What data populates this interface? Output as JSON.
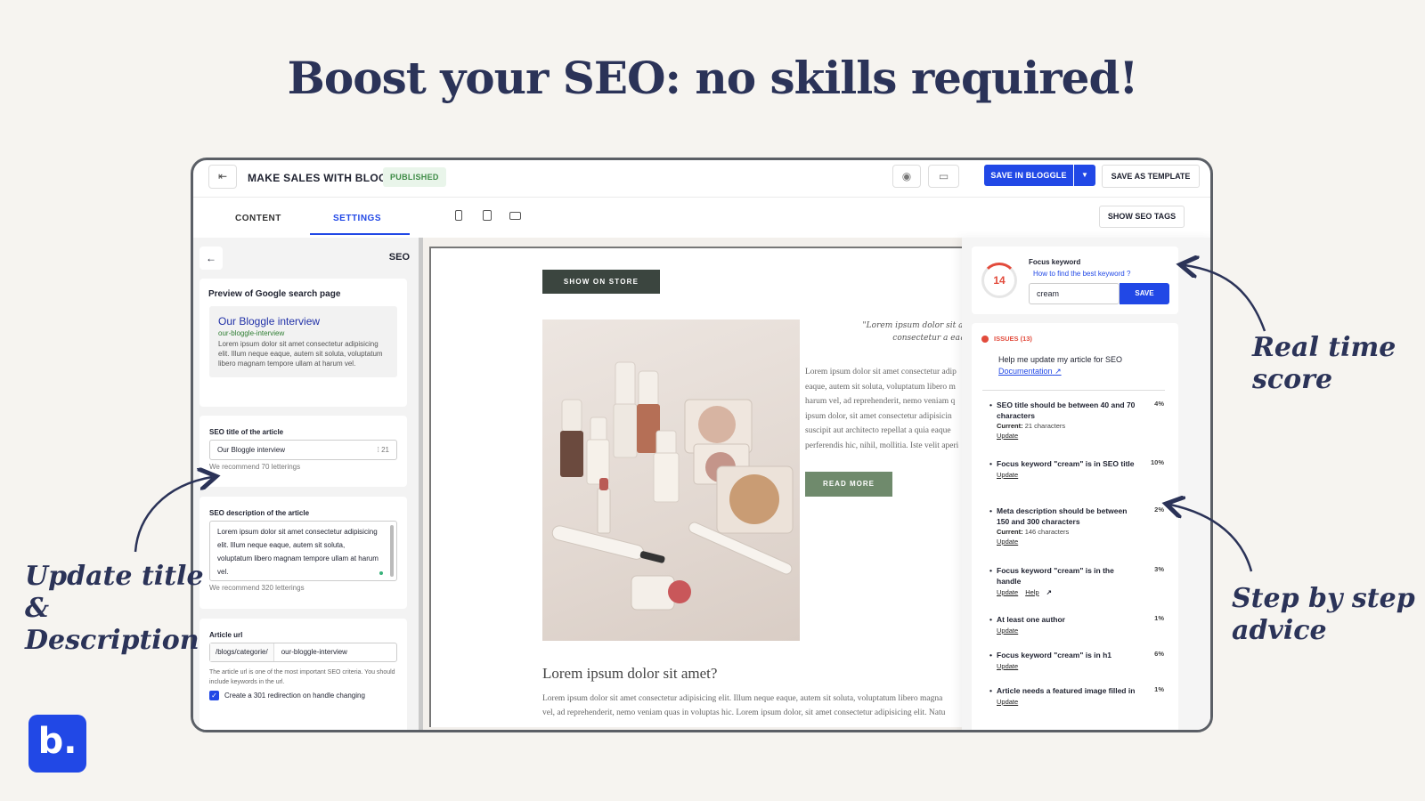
{
  "headline": "Boost your SEO: no skills required!",
  "topbar": {
    "back_icon": "exit-icon",
    "title": "MAKE SALES WITH BLOG",
    "status": "PUBLISHED",
    "save_label": "SAVE IN BLOGGLE",
    "save_template_label": "SAVE AS TEMPLATE",
    "accent": "#2148e6"
  },
  "tabs": [
    {
      "label": "CONTENT"
    },
    {
      "label": "SETTINGS"
    }
  ],
  "show_seo_tags": "SHOW SEO TAGS",
  "left": {
    "section": "SEO",
    "preview_heading": "Preview of Google search page",
    "google": {
      "title": "Our Bloggle interview",
      "url": "our-bloggle-interview",
      "desc": "Lorem ipsum dolor sit amet consectetur adipisicing elit. Illum neque eaque, autem sit soluta, voluptatum libero magnam tempore ullam at harum vel."
    },
    "seo_title_label": "SEO title of the article",
    "seo_title_value": "Our Bloggle interview",
    "seo_title_count": "21",
    "seo_title_hint": "We recommend 70 letterings",
    "seo_desc_label": "SEO description of the article",
    "seo_desc_value": "Lorem ipsum dolor sit amet consectetur adipisicing elit. Illum neque eaque, autem sit soluta, voluptatum libero magnam tempore ullam at harum vel.",
    "seo_desc_hint": "We recommend 320 letterings",
    "url_label": "Article url",
    "url_prefix": "/blogs/categorie/",
    "url_value": "our-bloggle-interview",
    "url_note": "The article url is one of the most important SEO criteria. You should include keywords in the url.",
    "redirect_label": "Create a 301 redirection on handle changing"
  },
  "preview": {
    "show_store": "SHOW ON STORE",
    "quote": "\"Lorem ipsum dolor sit amet consectetur a eaque\"",
    "body_lines": [
      "Lorem ipsum dolor sit amet consectetur adip",
      "eaque, autem sit soluta, voluptatum libero m",
      "harum vel, ad reprehenderit, nemo veniam q",
      "ipsum dolor, sit amet consectetur adipisicin",
      "suscipit aut architecto repellat a quia eaque",
      "perferendis hic, nihil, mollitia. Iste velit aperi"
    ],
    "read_more": "READ MORE",
    "heading": "Lorem ipsum dolor sit amet?",
    "para_lines": [
      "Lorem ipsum dolor sit amet consectetur adipisicing elit. Illum neque eaque, autem sit soluta, voluptatum libero magna",
      "vel, ad reprehenderit, nemo veniam quas in voluptas hic. Lorem ipsum dolor, sit amet consectetur adipisicing elit. Natu"
    ]
  },
  "right": {
    "score": "14",
    "focus_label": "Focus keyword",
    "focus_help": "How to find the best keyword ?",
    "keyword": "cream",
    "save": "SAVE",
    "issues_label": "ISSUES (13)",
    "help_text": "Help me update my article for SEO",
    "doc_link": "Documentation",
    "issues": [
      {
        "title": "SEO title should be between 40 and 70 characters",
        "pct": "4%",
        "current_label": "Current:",
        "current": "21 characters",
        "links": [
          "Update"
        ]
      },
      {
        "title": "Focus keyword \"cream\" is in SEO title",
        "pct": "10%",
        "links": [
          "Update"
        ]
      },
      {
        "title": "Meta description should be between 150 and 300 characters",
        "pct": "2%",
        "current_label": "Current:",
        "current": "146 characters",
        "links": [
          "Update"
        ]
      },
      {
        "title": "Focus keyword \"cream\" is in the handle",
        "pct": "3%",
        "links": [
          "Update",
          "Help"
        ]
      },
      {
        "title": "At least one author",
        "pct": "1%",
        "links": [
          "Update"
        ]
      },
      {
        "title": "Focus keyword \"cream\" is in h1",
        "pct": "6%",
        "links": [
          "Update"
        ]
      },
      {
        "title": "Article needs a featured image filled in",
        "pct": "1%",
        "links": [
          "Update"
        ]
      }
    ]
  },
  "annotations": {
    "update_title": "Update title",
    "update_amp": "&",
    "update_desc": "Description",
    "realtime_1": "Real time",
    "realtime_2": "score",
    "step_1": "Step by step",
    "step_2": "advice"
  },
  "logo": "b."
}
